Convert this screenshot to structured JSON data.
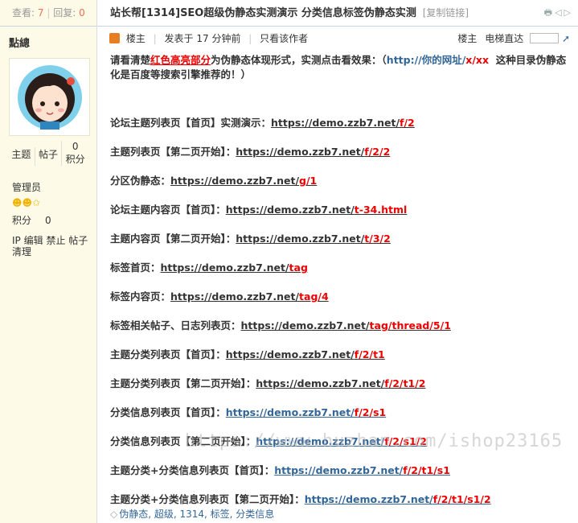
{
  "stats": {
    "views_label": "查看:",
    "views": "7",
    "replies_label": "回复:",
    "replies": "0"
  },
  "author": {
    "name": "點總",
    "topics_label": "主题",
    "posts_label": "帖子",
    "credits": "0",
    "credits_label": "积分",
    "group": "管理员",
    "score_label": "积分",
    "score": "0",
    "admin_links": [
      "IP",
      "编辑",
      "禁止",
      "帖子",
      "清理"
    ]
  },
  "thread": {
    "title": "站长帮[1314]SEO超级伪静态实测演示 分类信息标签伪静态实测",
    "copy_link": "[复制链接]"
  },
  "post_meta": {
    "floor_owner": "楼主",
    "posted": "发表于 17 分钟前",
    "only_author": "只看该作者",
    "floor": "楼主",
    "jump": "电梯直达"
  },
  "intro": {
    "p1": "请看清楚",
    "red": "红色高亮部分",
    "p2": "为伪静态体现形式，实测点击看效果：（",
    "url": "http://你的网址/",
    "url_red": "x/xx",
    "p3": "这种目录伪静态化是百度等搜索引擎推荐的！）"
  },
  "rows": [
    {
      "label": "论坛主题列表页【首页】实测演示：",
      "base": "https://demo.zzb7.net/",
      "path": "f/2",
      "style": "ln"
    },
    {
      "label": "主题列表页【第二页开始】：",
      "base": "https://demo.zzb7.net/",
      "path": "f/2/2",
      "style": "ln"
    },
    {
      "label": "分区伪静态：",
      "base": "https://demo.zzb7.net/",
      "path": "g/1",
      "style": "ln"
    },
    {
      "label": "论坛主题内容页【首页】：",
      "base": "https://demo.zzb7.net/",
      "path": "t-34.html",
      "style": "ln"
    },
    {
      "label": "主题内容页【第二页开始】：",
      "base": "https://demo.zzb7.net/",
      "path": "t/3/2",
      "style": "ln"
    },
    {
      "label": "标签首页：",
      "base": "https://demo.zzb7.net/",
      "path": "tag",
      "style": "ln"
    },
    {
      "label": "标签内容页：",
      "base": "https://demo.zzb7.net/",
      "path": "tag/4",
      "style": "ln"
    },
    {
      "label": "标签相关帖子、日志列表页：",
      "base": "https://demo.zzb7.net/",
      "path": "tag/thread/5/1",
      "style": "ln"
    },
    {
      "label": "主题分类列表页【首页】：",
      "base": "https://demo.zzb7.net/",
      "path": "f/2/t1",
      "style": "ln"
    },
    {
      "label": "主题分类列表页【第二页开始】：",
      "base": "https://demo.zzb7.net/",
      "path": "f/2/t1/2",
      "style": "ln"
    },
    {
      "label": "分类信息列表页【首页】：",
      "base": "https://demo.zzb7.net/",
      "path": "f/2/s1",
      "style": "lb"
    },
    {
      "label": "分类信息列表页【第二页开始】：",
      "base": "https://demo.zzb7.net/",
      "path": "f/2/s1/2",
      "style": "lb"
    },
    {
      "label": "主题分类+分类信息列表页【首页】：",
      "base": "https://demo.zzb7.net/",
      "path": "f/2/t1/s1",
      "style": "lb"
    },
    {
      "label": "主题分类+分类信息列表页【第二页开始】：",
      "base": "https://demo.zzb7.net/",
      "path": "f/2/t1/s1/2",
      "style": "lb"
    }
  ],
  "tags": "伪静态, 超级, 1314, 标签, 分类信息",
  "watermark": "https://www.huzhan.com/ishop23165",
  "colors": {
    "accent_red": "#e00000",
    "link_blue": "#336699",
    "sidebar_bg": "#fdfbe8"
  }
}
